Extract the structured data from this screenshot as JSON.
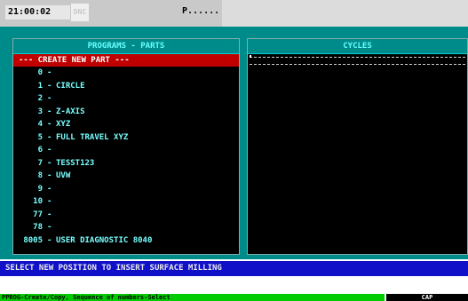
{
  "header": {
    "time": "21:00:02",
    "mode_badge": "DNC",
    "program_indicator": "P......"
  },
  "programs_panel": {
    "title": "PROGRAMS - PARTS",
    "create_label": "--- CREATE NEW PART ---",
    "parts": [
      {
        "num": "0",
        "name": ""
      },
      {
        "num": "1",
        "name": "CIRCLE"
      },
      {
        "num": "2",
        "name": ""
      },
      {
        "num": "3",
        "name": "Z-AXIS"
      },
      {
        "num": "4",
        "name": "XYZ"
      },
      {
        "num": "5",
        "name": "FULL TRAVEL XYZ"
      },
      {
        "num": "6",
        "name": ""
      },
      {
        "num": "7",
        "name": "TESST123"
      },
      {
        "num": "8",
        "name": "UVW"
      },
      {
        "num": "9",
        "name": ""
      },
      {
        "num": "10",
        "name": ""
      },
      {
        "num": "77",
        "name": ""
      },
      {
        "num": "78",
        "name": ""
      },
      {
        "num": "8005",
        "name": "USER DIAGNOSTIC 8040"
      }
    ]
  },
  "cycles_panel": {
    "title": "CYCLES"
  },
  "message": "SELECT NEW POSITION TO INSERT SURFACE MILLING",
  "status_bar": {
    "hint": "PPROG-Create/Copy, Sequence of numbers-Select",
    "indicator": "CAP"
  },
  "colors": {
    "background": "#008b8b",
    "panel": "#000000",
    "text": "#77ffff",
    "selection": "#c00000",
    "message_bar": "#1010c8",
    "status_bar": "#00cc00"
  }
}
